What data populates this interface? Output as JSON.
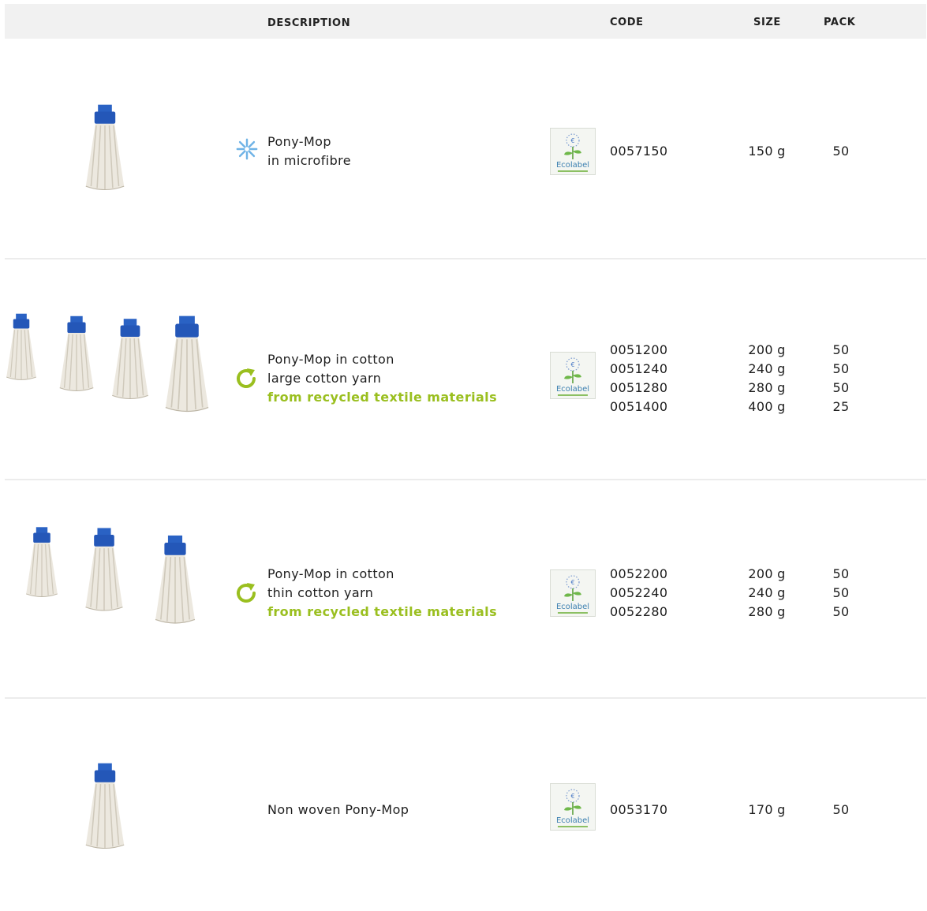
{
  "header": {
    "description": "DESCRIPTION",
    "code": "CODE",
    "size": "SIZE",
    "pack": "PACK"
  },
  "colors": {
    "header_bg": "#f1f1f1",
    "recycle_green": "#9abf1f",
    "microfibre_blue": "#6fb3e6",
    "mop_cap_blue": "#2a62c4"
  },
  "rows": [
    {
      "icon": "microfibre-snowflake-icon",
      "desc_lines": [
        "Pony-Mop",
        "in microfibre"
      ],
      "green_line": "",
      "ecolabel": "Ecolabel",
      "codes": [
        "0057150"
      ],
      "sizes": [
        "150 g"
      ],
      "packs": [
        "50"
      ]
    },
    {
      "icon": "recycle-icon",
      "desc_lines": [
        "Pony-Mop in cotton",
        "large cotton yarn"
      ],
      "green_line": "from recycled textile materials",
      "ecolabel": "Ecolabel",
      "codes": [
        "0051200",
        "0051240",
        "0051280",
        "0051400"
      ],
      "sizes": [
        "200 g",
        "240 g",
        "280 g",
        "400 g"
      ],
      "packs": [
        "50",
        "50",
        "50",
        "25"
      ]
    },
    {
      "icon": "recycle-icon",
      "desc_lines": [
        "Pony-Mop in cotton",
        "thin cotton yarn"
      ],
      "green_line": "from recycled textile materials",
      "ecolabel": "Ecolabel",
      "codes": [
        "0052200",
        "0052240",
        "0052280"
      ],
      "sizes": [
        "200 g",
        "240 g",
        "280 g"
      ],
      "packs": [
        "50",
        "50",
        "50"
      ]
    },
    {
      "icon": "",
      "desc_lines": [
        "Non woven Pony-Mop"
      ],
      "green_line": "",
      "ecolabel": "Ecolabel",
      "codes": [
        "0053170"
      ],
      "sizes": [
        "170 g"
      ],
      "packs": [
        "50"
      ]
    }
  ]
}
